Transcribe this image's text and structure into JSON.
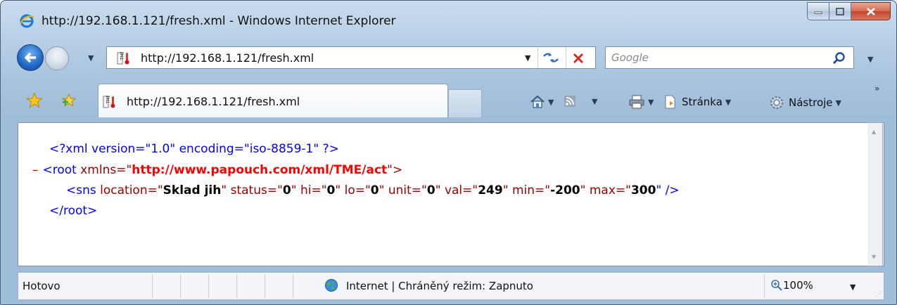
{
  "window": {
    "title": "http://192.168.1.121/fresh.xml - Windows Internet Explorer",
    "icon": "ie-logo-icon",
    "minimize_icon": "minimize-icon",
    "maximize_icon": "maximize-icon",
    "close_icon": "close-icon"
  },
  "nav": {
    "back_icon": "back-arrow-icon",
    "forward_icon": "forward-arrow-icon",
    "history_dropdown": "▼",
    "address": "http://192.168.1.121/fresh.xml",
    "address_dropdown": "▼",
    "refresh_icon": "refresh-icon",
    "stop_icon": "stop-icon",
    "search_placeholder": "Google",
    "search_icon": "search-icon",
    "search_dropdown": "▼"
  },
  "tabs": {
    "favorites_icon": "favorites-star-icon",
    "add_favorite_icon": "add-favorite-icon",
    "active_tab_title": "http://192.168.1.121/fresh.xml",
    "new_tab_icon": "new-tab-icon"
  },
  "command_bar": {
    "home_icon": "home-icon",
    "feeds_icon": "feeds-icon",
    "print_icon": "print-icon",
    "page_label": "Stránka",
    "tools_label": "Nástroje",
    "dropdown": "▼",
    "overflow": "»"
  },
  "document": {
    "line1": "<?xml version=\"1.0\" encoding=\"iso-8859-1\" ?>",
    "collapse": "–",
    "root_open": "<root",
    "root_attr": " xmlns=\"",
    "root_ns": "http://www.papouch.com/xml/TME/act",
    "root_close": "\">",
    "sns": {
      "open": "<sns",
      "location_attr": " location=\"",
      "location": "Sklad jih",
      "status_attr": "\" status=\"",
      "status": "0",
      "hi_attr": "\" hi=\"",
      "hi": "0",
      "lo_attr": "\" lo=\"",
      "lo": "0",
      "unit_attr": "\" unit=\"",
      "unit": "0",
      "val_attr": "\" val=\"",
      "val": "249",
      "min_attr": "\" min=\"",
      "min": "-200",
      "max_attr": "\" max=\"",
      "max": "300",
      "end": "\" />"
    },
    "root_end": "</root>"
  },
  "status_bar": {
    "status": "Hotovo",
    "zone": "Internet | Chráněný režim: Zapnuto",
    "zone_icon": "globe-icon",
    "zoom": "100%",
    "zoom_icon": "zoom-icon",
    "zoom_dropdown": "▼"
  }
}
